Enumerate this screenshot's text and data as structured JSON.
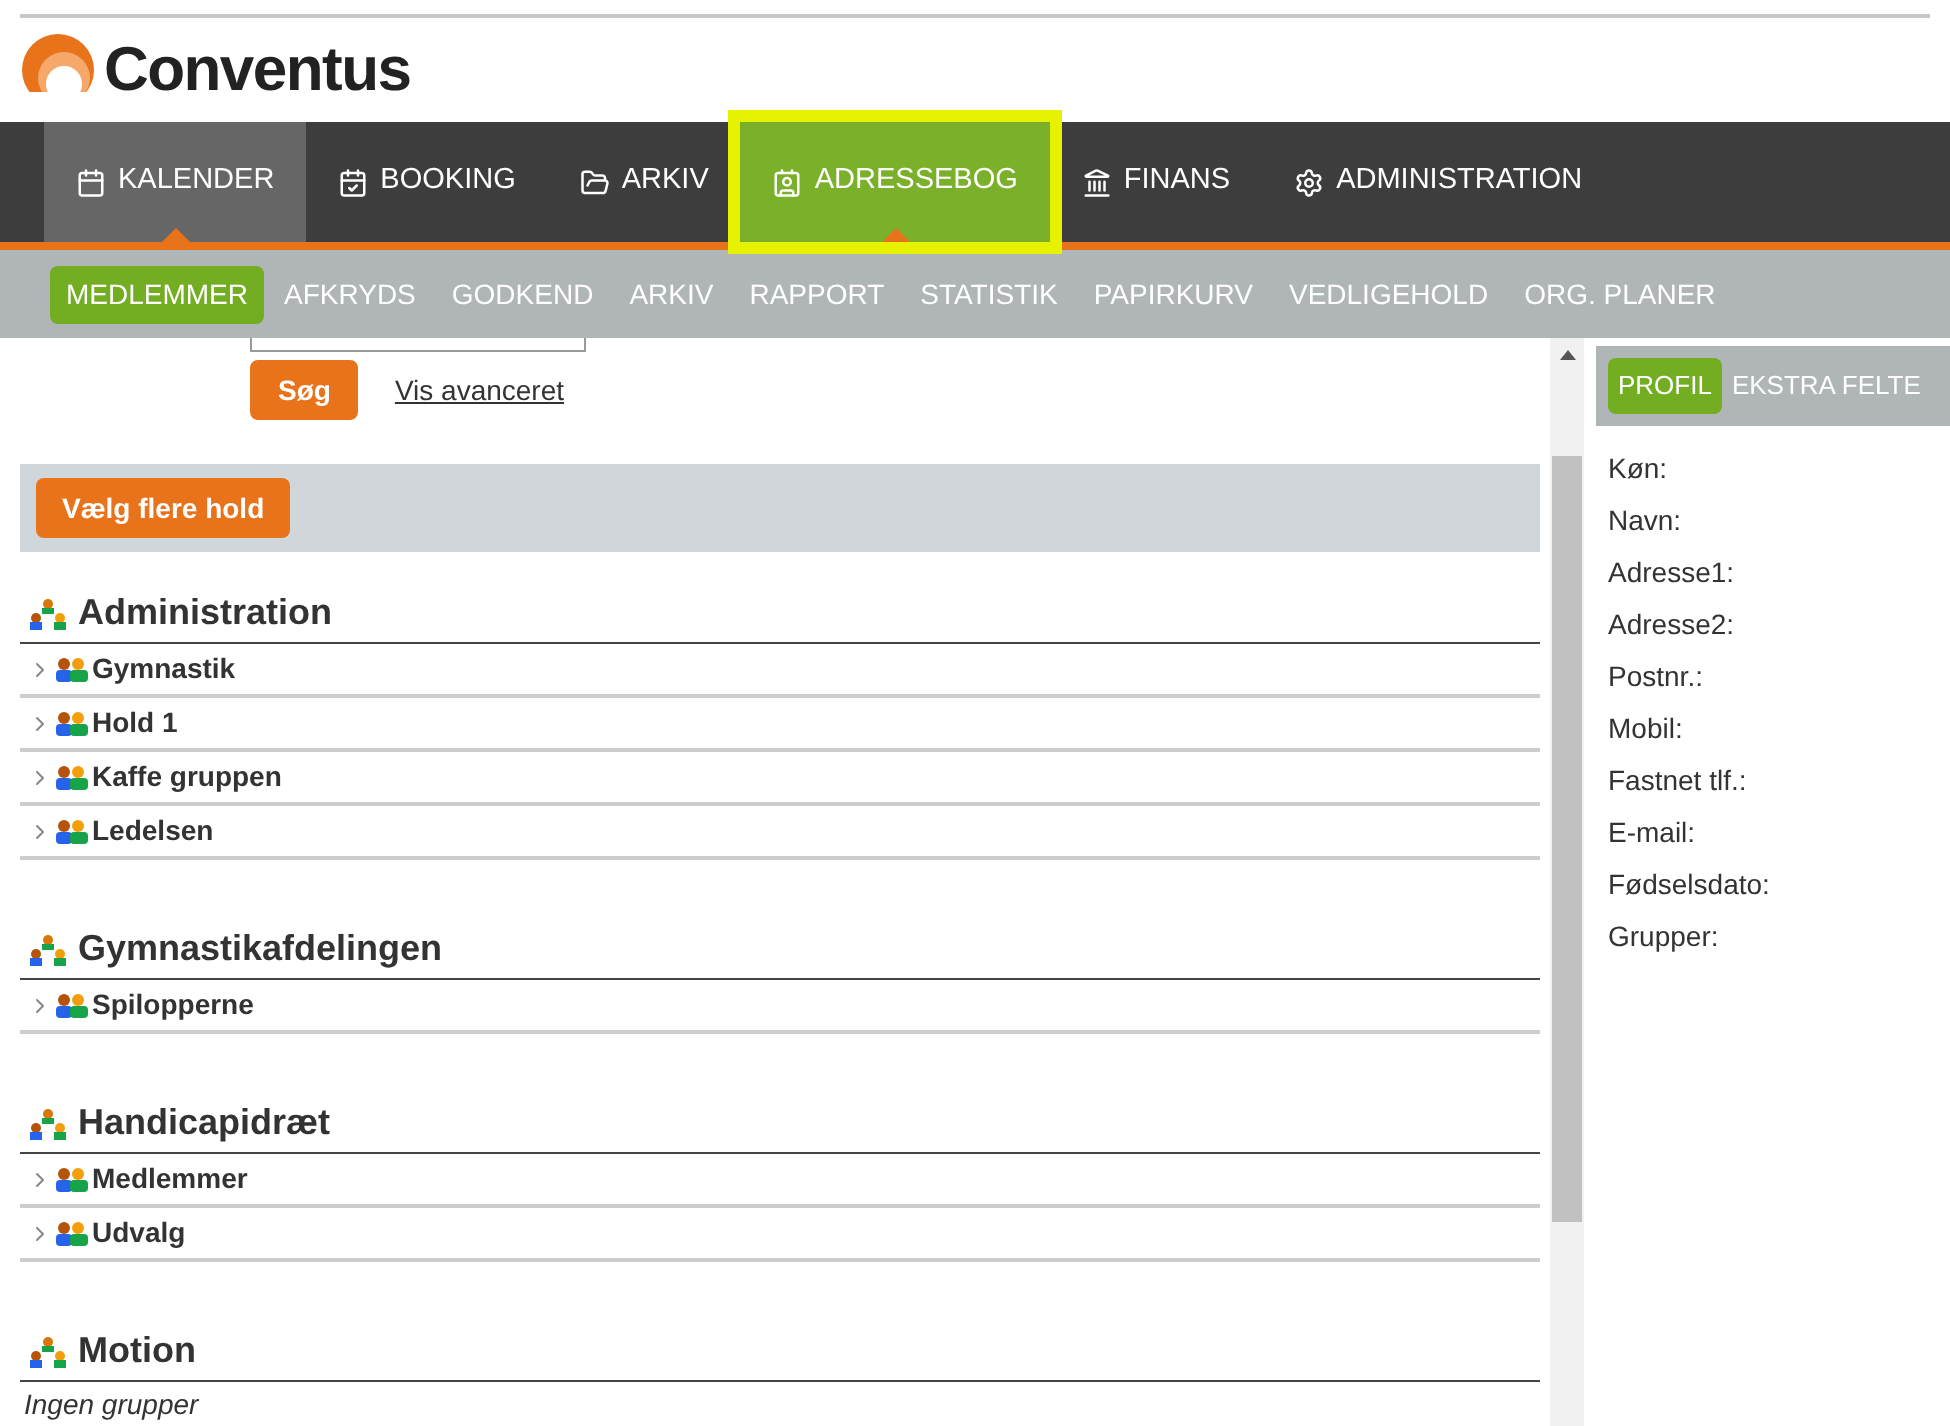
{
  "logo": {
    "text": "Conventus"
  },
  "nav": [
    {
      "label": "KALENDER",
      "selected": true,
      "highlighted": false
    },
    {
      "label": "BOOKING",
      "selected": false,
      "highlighted": false
    },
    {
      "label": "ARKIV",
      "selected": false,
      "highlighted": false
    },
    {
      "label": "ADRESSEBOG",
      "selected": false,
      "highlighted": true
    },
    {
      "label": "FINANS",
      "selected": false,
      "highlighted": false
    },
    {
      "label": "ADMINISTRATION",
      "selected": false,
      "highlighted": false
    }
  ],
  "subnav": [
    {
      "label": "MEDLEMMER",
      "selected": true
    },
    {
      "label": "AFKRYDS",
      "selected": false
    },
    {
      "label": "GODKEND",
      "selected": false
    },
    {
      "label": "ARKIV",
      "selected": false
    },
    {
      "label": "RAPPORT",
      "selected": false
    },
    {
      "label": "STATISTIK",
      "selected": false
    },
    {
      "label": "PAPIRKURV",
      "selected": false
    },
    {
      "label": "VEDLIGEHOLD",
      "selected": false
    },
    {
      "label": "ORG. PLANER",
      "selected": false
    }
  ],
  "search": {
    "button": "Søg",
    "advanced_link": "Vis avanceret"
  },
  "select_button": "Vælg flere hold",
  "departments": [
    {
      "name": "Administration",
      "groups": [
        "Gymnastik",
        "Hold 1",
        "Kaffe gruppen",
        "Ledelsen"
      ]
    },
    {
      "name": "Gymnastikafdelingen",
      "groups": [
        "Spilopperne"
      ]
    },
    {
      "name": "Handicapidræt",
      "groups": [
        "Medlemmer",
        "Udvalg"
      ]
    },
    {
      "name": "Motion",
      "empty_text": "Ingen grupper"
    }
  ],
  "profile": {
    "tabs": [
      {
        "label": "PROFIL",
        "selected": true
      },
      {
        "label": "EKSTRA FELTE",
        "selected": false
      }
    ],
    "fields": [
      "Køn:",
      "Navn:",
      "Adresse1:",
      "Adresse2:",
      "Postnr.:",
      "Mobil:",
      "Fastnet tlf.:",
      "E-mail:",
      "Fødselsdato:",
      "Grupper:"
    ]
  }
}
